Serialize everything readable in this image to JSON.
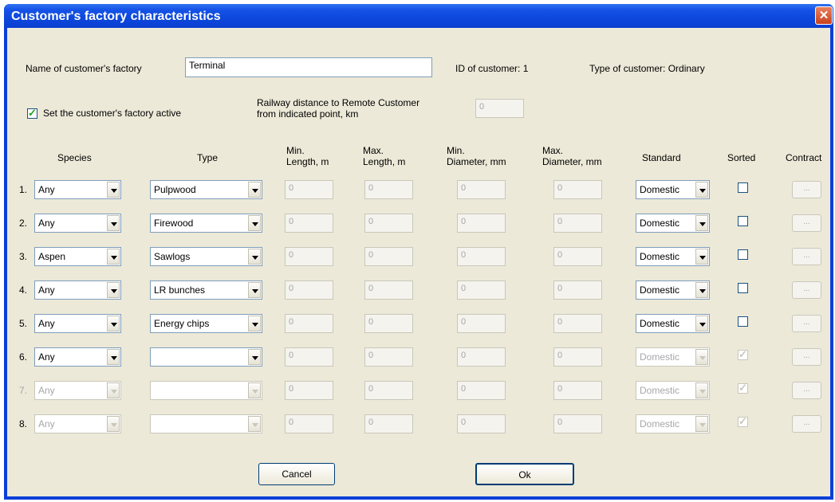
{
  "window": {
    "title": "Customer's factory characteristics",
    "close_glyph": "✕"
  },
  "factory": {
    "name_label": "Name of customer's factory",
    "name_value": "Terminal",
    "id_text": "ID of customer: 1",
    "type_text": "Type of customer: Ordinary"
  },
  "active": {
    "label": "Set the customer's factory active",
    "checked": true
  },
  "railway": {
    "label_line1": "Railway distance to Remote Customer",
    "label_line2": "from indicated point, km",
    "value": "0"
  },
  "headers": {
    "species": "Species",
    "type": "Type",
    "min_length_1": "Min.",
    "min_length_2": "Length, m",
    "max_length_1": "Max.",
    "max_length_2": "Length, m",
    "min_diam_1": "Min.",
    "min_diam_2": "Diameter, mm",
    "max_diam_1": "Max.",
    "max_diam_2": "Diameter, mm",
    "standard": "Standard",
    "sorted": "Sorted",
    "contract": "Contract"
  },
  "rows": [
    {
      "num": "1.",
      "species": "Any",
      "type": "Pulpwood",
      "min_len": "0",
      "max_len": "0",
      "min_diam": "0",
      "max_diam": "0",
      "standard": "Domestic",
      "contract": "..."
    },
    {
      "num": "2.",
      "species": "Any",
      "type": "Firewood",
      "min_len": "0",
      "max_len": "0",
      "min_diam": "0",
      "max_diam": "0",
      "standard": "Domestic",
      "contract": "..."
    },
    {
      "num": "3.",
      "species": "Aspen",
      "type": "Sawlogs",
      "min_len": "0",
      "max_len": "0",
      "min_diam": "0",
      "max_diam": "0",
      "standard": "Domestic",
      "contract": "..."
    },
    {
      "num": "4.",
      "species": "Any",
      "type": "LR bunches",
      "min_len": "0",
      "max_len": "0",
      "min_diam": "0",
      "max_diam": "0",
      "standard": "Domestic",
      "contract": "..."
    },
    {
      "num": "5.",
      "species": "Any",
      "type": "Energy chips",
      "min_len": "0",
      "max_len": "0",
      "min_diam": "0",
      "max_diam": "0",
      "standard": "Domestic",
      "contract": "..."
    },
    {
      "num": "6.",
      "species": "Any",
      "type": "",
      "min_len": "0",
      "max_len": "0",
      "min_diam": "0",
      "max_diam": "0",
      "standard": "Domestic",
      "contract": "..."
    },
    {
      "num": "7.",
      "species": "Any",
      "type": "",
      "min_len": "0",
      "max_len": "0",
      "min_diam": "0",
      "max_diam": "0",
      "standard": "Domestic",
      "contract": "..."
    },
    {
      "num": "8.",
      "species": "Any",
      "type": "",
      "min_len": "0",
      "max_len": "0",
      "min_diam": "0",
      "max_diam": "0",
      "standard": "Domestic",
      "contract": "..."
    }
  ],
  "buttons": {
    "cancel": "Cancel",
    "ok": "Ok"
  }
}
